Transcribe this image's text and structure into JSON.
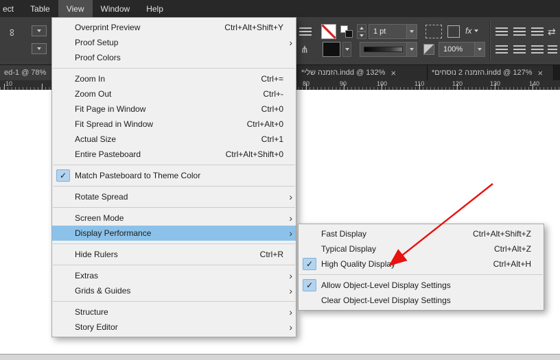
{
  "glyphs": {
    "check": "✓",
    "submenu_arrow": "›",
    "close": "×",
    "link": "∞",
    "flip": "⋔",
    "swap": "⇄"
  },
  "menubar": {
    "items": [
      {
        "label": "ect"
      },
      {
        "label": "Table"
      },
      {
        "label": "View"
      },
      {
        "label": "Window"
      },
      {
        "label": "Help"
      }
    ]
  },
  "toolbar": {
    "stroke_weight": "1 pt",
    "opacity": "100%",
    "effects_label": "fx"
  },
  "tabs": [
    {
      "title": "ed-1 @ 78%"
    },
    {
      "title": "*הזמנה שלי.indd @ 132%"
    },
    {
      "title": "*הזמנה 2 נוסחים.indd @ 127%"
    }
  ],
  "ruler": {
    "labels": [
      "10",
      "80",
      "90",
      "100",
      "110",
      "120",
      "130",
      "140"
    ]
  },
  "view_menu": {
    "items": [
      {
        "label": "Overprint Preview",
        "shortcut": "Ctrl+Alt+Shift+Y"
      },
      {
        "label": "Proof Setup"
      },
      {
        "label": "Proof Colors"
      },
      {
        "label": "Zoom In",
        "shortcut": "Ctrl+="
      },
      {
        "label": "Zoom Out",
        "shortcut": "Ctrl+-"
      },
      {
        "label": "Fit Page in Window",
        "shortcut": "Ctrl+0"
      },
      {
        "label": "Fit Spread in Window",
        "shortcut": "Ctrl+Alt+0"
      },
      {
        "label": "Actual Size",
        "shortcut": "Ctrl+1"
      },
      {
        "label": "Entire Pasteboard",
        "shortcut": "Ctrl+Alt+Shift+0"
      },
      {
        "label": "Match Pasteboard to Theme Color",
        "checked": true
      },
      {
        "label": "Rotate Spread"
      },
      {
        "label": "Screen Mode"
      },
      {
        "label": "Display Performance",
        "highlighted": true
      },
      {
        "label": "Hide Rulers",
        "shortcut": "Ctrl+R"
      },
      {
        "label": "Extras"
      },
      {
        "label": "Grids & Guides"
      },
      {
        "label": "Structure"
      },
      {
        "label": "Story Editor"
      }
    ]
  },
  "display_submenu": {
    "items": [
      {
        "label": "Fast Display",
        "shortcut": "Ctrl+Alt+Shift+Z"
      },
      {
        "label": "Typical Display",
        "shortcut": "Ctrl+Alt+Z"
      },
      {
        "label": "High Quality Display",
        "shortcut": "Ctrl+Alt+H",
        "checked": true
      },
      {
        "label": "Allow Object-Level Display Settings",
        "checked": true
      },
      {
        "label": "Clear Object-Level Display Settings"
      }
    ]
  },
  "colors": {
    "menu_highlight": "#8cc2ea",
    "check_box_bg": "#b3d3ee",
    "annotation_arrow": "#e8120e"
  }
}
